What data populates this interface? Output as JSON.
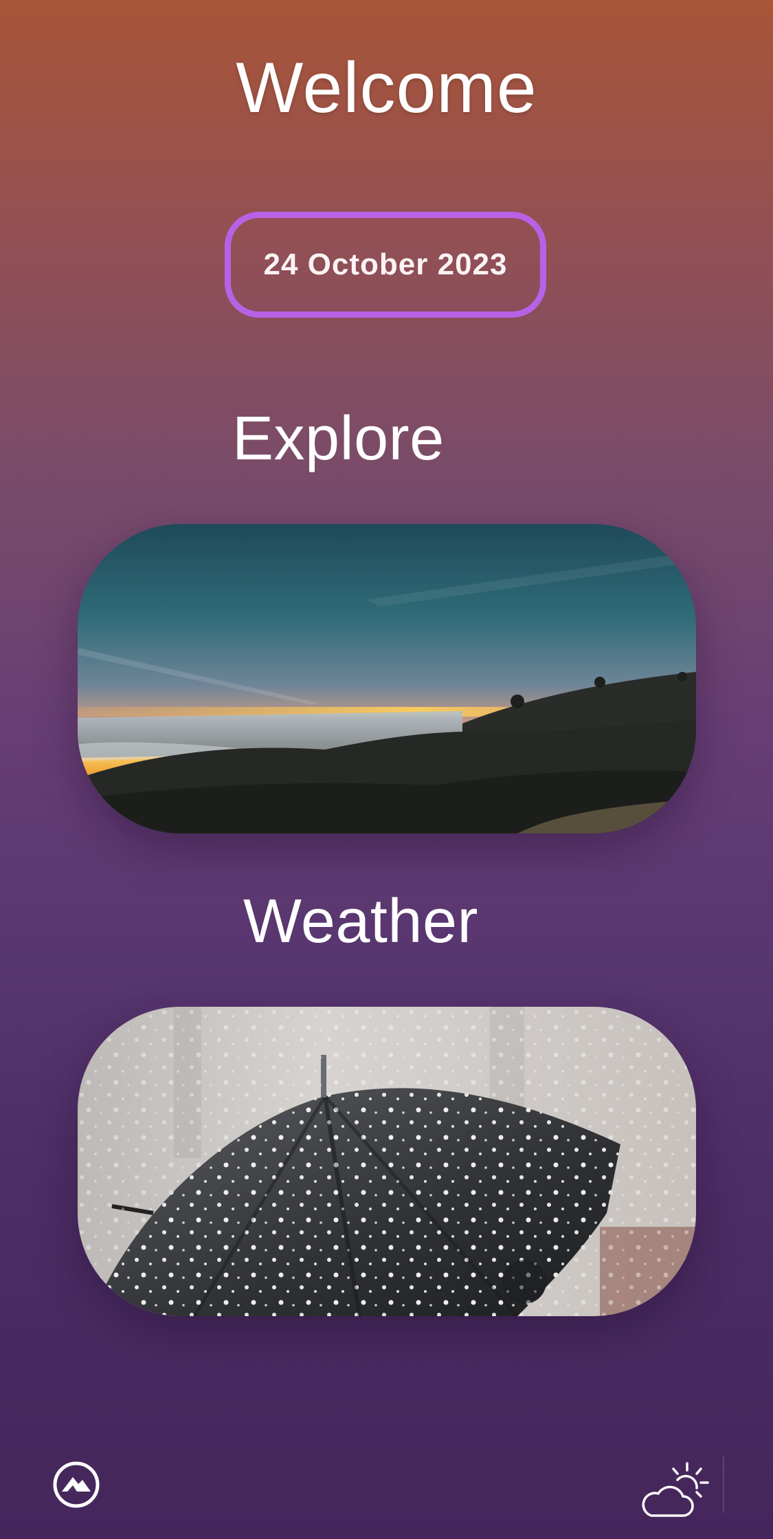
{
  "header": {
    "title": "Welcome"
  },
  "date_button": {
    "label": "24 October 2023"
  },
  "sections": {
    "explore": {
      "title": "Explore",
      "image_icon": "sunset-landscape-image"
    },
    "weather": {
      "title": "Weather",
      "image_icon": "snowy-umbrella-image"
    }
  },
  "tab_bar": {
    "left_icon": "mountain-icon",
    "right_icon": "partly-cloudy-icon"
  },
  "colors": {
    "accent_pill_border": "#b762e6",
    "background_top": "#a95538",
    "background_bottom": "#45265b"
  }
}
